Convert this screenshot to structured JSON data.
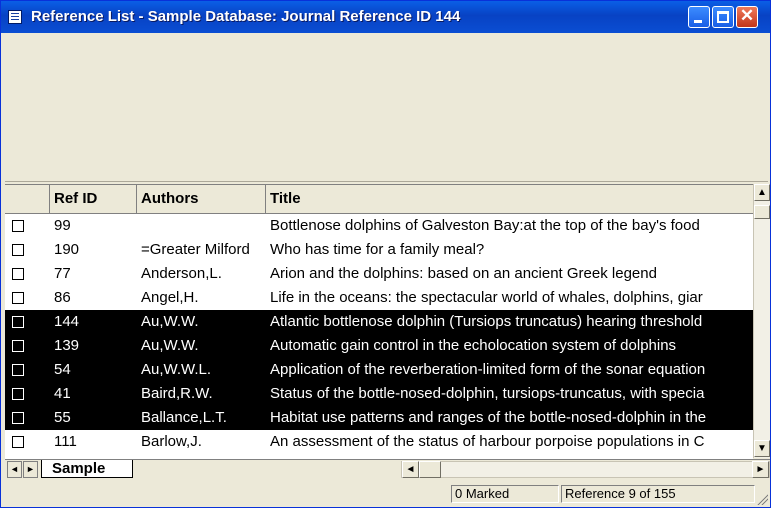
{
  "window": {
    "title": "Reference List - Sample Database: Journal Reference ID 144",
    "minimize_icon": "minimize-icon",
    "maximize_icon": "maximize-icon",
    "close_icon": "close-icon",
    "close_glyph": "✕"
  },
  "table": {
    "columns": [
      "Ref ID",
      "Authors",
      "Title"
    ],
    "rows": [
      {
        "ref_id": "99",
        "authors": "",
        "title": "Bottlenose dolphins of Galveston Bay:at the top of the bay's food",
        "selected": false
      },
      {
        "ref_id": "190",
        "authors": "=Greater Milford",
        "title": "Who has time for a family meal?",
        "selected": false
      },
      {
        "ref_id": "77",
        "authors": "Anderson,L.",
        "title": "Arion and the dolphins: based on an ancient Greek legend",
        "selected": false
      },
      {
        "ref_id": "86",
        "authors": "Angel,H.",
        "title": "Life in the oceans: the spectacular world of whales, dolphins, giar",
        "selected": false
      },
      {
        "ref_id": "144",
        "authors": "Au,W.W.",
        "title": "Atlantic bottlenose dolphin (Tursiops truncatus) hearing threshold",
        "selected": true
      },
      {
        "ref_id": "139",
        "authors": "Au,W.W.",
        "title": "Automatic gain control in the echolocation system of dolphins",
        "selected": true
      },
      {
        "ref_id": "54",
        "authors": "Au,W.W.L.",
        "title": "Application of the reverberation-limited form of the sonar equation",
        "selected": true
      },
      {
        "ref_id": "41",
        "authors": "Baird,R.W.",
        "title": "Status of the bottle-nosed-dolphin, tursiops-truncatus, with specia",
        "selected": true
      },
      {
        "ref_id": "55",
        "authors": "Ballance,L.T.",
        "title": "Habitat use patterns and ranges of the bottle-nosed-dolphin in the",
        "selected": true
      },
      {
        "ref_id": "111",
        "authors": "Barlow,J.",
        "title": "An assessment of the status of harbour porpoise populations in C",
        "selected": false
      }
    ]
  },
  "scroll": {
    "up_arrow": "▲",
    "down_arrow": "▼",
    "left_arrow": "◄",
    "right_arrow": "►"
  },
  "sheet_tabs": {
    "first_nav": "◄",
    "next_nav": "►",
    "active": "Sample"
  },
  "status": {
    "marked": "0 Marked",
    "position": "Reference 9 of 155"
  }
}
